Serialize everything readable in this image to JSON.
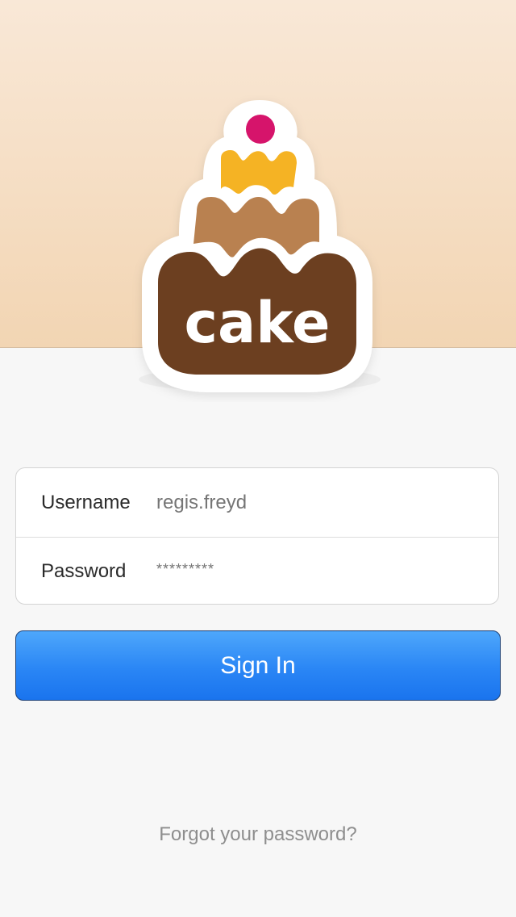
{
  "logo": {
    "wordmark": "cake",
    "colors": {
      "cherry": "#d6146b",
      "top_tier": "#f5b324",
      "middle_tier": "#b98150",
      "bottom_tier": "#6c3f20",
      "outline": "#ffffff"
    }
  },
  "login_form": {
    "username_label": "Username",
    "username_placeholder": "regis.freyd",
    "password_label": "Password",
    "password_placeholder": "*********"
  },
  "sign_in_button": {
    "label": "Sign In",
    "color": "#2a86f5"
  },
  "forgot_password_link": "Forgot your password?"
}
